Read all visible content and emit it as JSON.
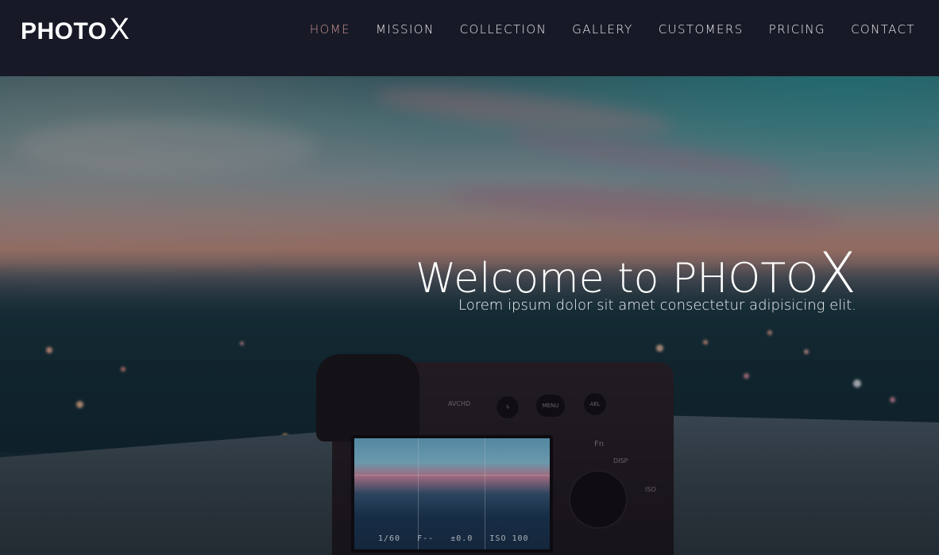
{
  "brand": {
    "logo_main": "PHOTO",
    "logo_x": "X"
  },
  "nav": {
    "items": [
      {
        "label": "HOME",
        "active": true
      },
      {
        "label": "MISSION",
        "active": false
      },
      {
        "label": "COLLECTION",
        "active": false
      },
      {
        "label": "GALLERY",
        "active": false
      },
      {
        "label": "CUSTOMERS",
        "active": false
      },
      {
        "label": "PRICING",
        "active": false
      },
      {
        "label": "CONTACT",
        "active": false
      }
    ]
  },
  "hero": {
    "welcome": "Welcome to ",
    "brand": "PHOTO",
    "brand_x": "X",
    "subtitle": "Lorem ipsum dolor sit amet consectetur adipisicing elit.",
    "image_description": "camera-on-ledge-overlooking-city-at-dusk"
  },
  "camera": {
    "screen_readout": "1/60   F--   ±0.0   ISO 100",
    "buttons": {
      "menu": "MENU",
      "ael": "AEL",
      "fn": "Fn",
      "disp": "DISP",
      "iso": "ISO"
    },
    "label_avchd": "AVCHD"
  },
  "colors": {
    "navbar_bg": "#171a26",
    "nav_text": "#e8e8ec",
    "nav_active": "#c98f90",
    "hero_text": "#ffffff"
  }
}
